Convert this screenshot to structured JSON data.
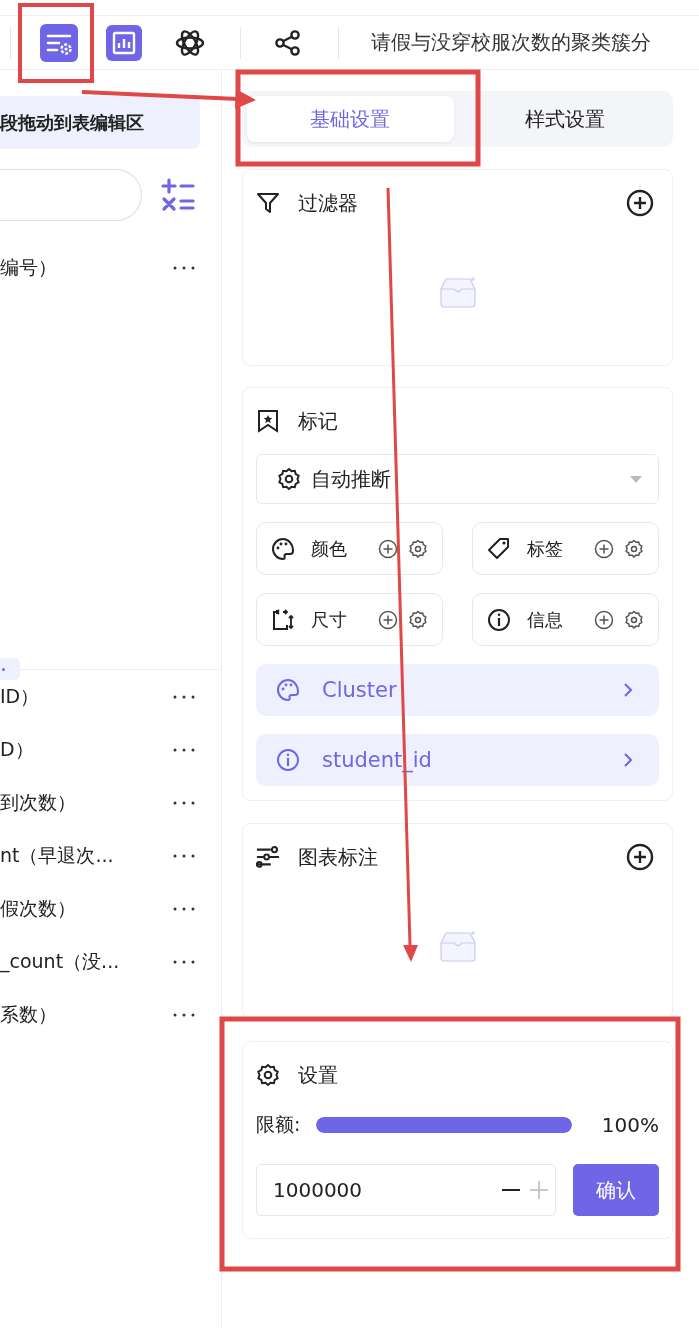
{
  "toolbar": {
    "title": "请假与没穿校服次数的聚类簇分"
  },
  "field_panel": {
    "drag_hint_button": "段拖动到表编辑区",
    "fields_top": [
      {
        "label": "编号）"
      }
    ],
    "fields_bottom": [
      {
        "label": "ID）"
      },
      {
        "label": "D）"
      },
      {
        "label": "到次数）"
      },
      {
        "label": "nt（早退次..."
      },
      {
        "label": "假次数）"
      },
      {
        "label": "_count（没..."
      },
      {
        "label": "系数）"
      }
    ]
  },
  "config_panel": {
    "tabs": [
      {
        "label": "基础设置",
        "selected": true
      },
      {
        "label": "样式设置",
        "selected": false
      }
    ],
    "filters": {
      "title": "过滤器"
    },
    "marks": {
      "title": "标记",
      "mark_type": "自动推断",
      "encodings": [
        {
          "kind": "color",
          "label": "颜色"
        },
        {
          "kind": "label",
          "label": "标签"
        },
        {
          "kind": "size",
          "label": "尺寸"
        },
        {
          "kind": "info",
          "label": "信息"
        }
      ],
      "fields": [
        {
          "kind": "color",
          "name": "Cluster"
        },
        {
          "kind": "info",
          "name": "student_id"
        }
      ]
    },
    "chart_annotations": {
      "title": "图表标注"
    },
    "settings": {
      "title": "设置",
      "limit_label": "限额:",
      "level": 1,
      "reading": "100%",
      "limit_value": "1000000",
      "confirm_button": "确认"
    }
  }
}
